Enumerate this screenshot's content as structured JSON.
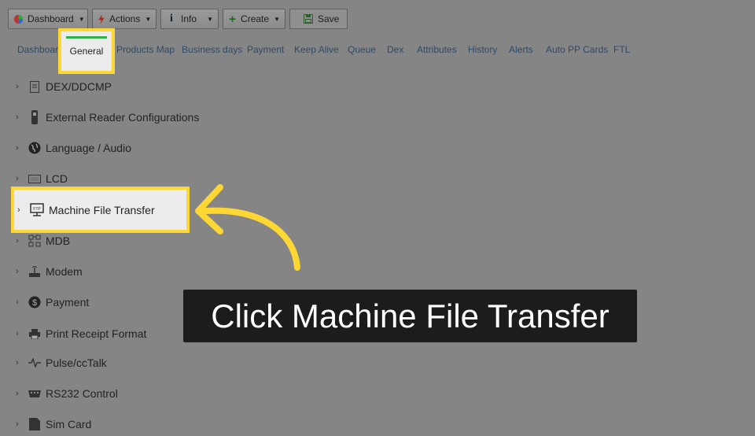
{
  "toolbar": {
    "buttons": [
      {
        "label": "Dashboard",
        "icon": "pie-chart-icon"
      },
      {
        "label": "Actions",
        "icon": "lightning-icon"
      },
      {
        "label": "Info",
        "icon": "info-icon"
      },
      {
        "label": "Create",
        "icon": "plus-icon"
      },
      {
        "label": "Save",
        "icon": "save-icon"
      }
    ]
  },
  "tabs": [
    "Dashboard",
    "General",
    "Products Map",
    "Business days",
    "Payment",
    "Keep Alive",
    "Queue",
    "Dex",
    "Attributes",
    "History",
    "Alerts",
    "Auto PP Cards",
    "FTL"
  ],
  "tree": {
    "items": [
      {
        "label": "DEX/DDCMP",
        "icon": "dex-icon"
      },
      {
        "label": "External Reader Configurations",
        "icon": "card-reader-icon"
      },
      {
        "label": "Language / Audio",
        "icon": "globe-icon"
      },
      {
        "label": "LCD",
        "icon": "lcd-icon"
      },
      {
        "label": "Machine File Transfer",
        "icon": "ftp-icon"
      },
      {
        "label": "MDB",
        "icon": "mdb-icon"
      },
      {
        "label": "Modem",
        "icon": "modem-icon"
      },
      {
        "label": "Payment",
        "icon": "dollar-icon"
      },
      {
        "label": "Print Receipt Format",
        "icon": "printer-icon"
      },
      {
        "label": "Pulse/ccTalk",
        "icon": "pulse-icon"
      },
      {
        "label": "RS232 Control",
        "icon": "rs232-icon"
      },
      {
        "label": "Sim Card",
        "icon": "sim-card-icon"
      }
    ]
  },
  "callout": {
    "text": "Click Machine File Transfer"
  },
  "colors": {
    "highlight": "#fdd835",
    "active_tab": "#2fb24b",
    "callout_bg": "#1c1c1c"
  }
}
